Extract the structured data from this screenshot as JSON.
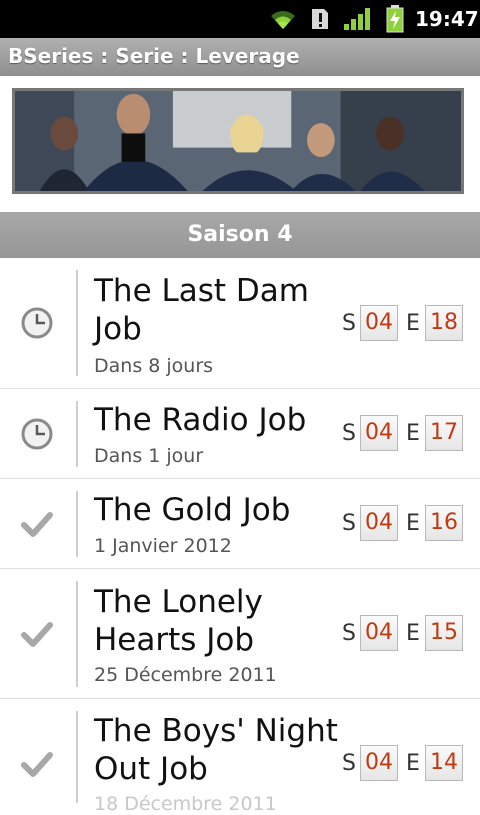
{
  "status_bar": {
    "time": "19:47"
  },
  "app": {
    "title": "BSeries : Serie : Leverage"
  },
  "banner": {
    "alt": "Leverage cast photo"
  },
  "season": {
    "label": "Saison 4"
  },
  "labels": {
    "season_prefix": "S",
    "episode_prefix": "E"
  },
  "episodes": [
    {
      "title": "The Last Dam Job",
      "date": "Dans 8 jours",
      "season": "04",
      "episode": "18",
      "status": "upcoming"
    },
    {
      "title": "The Radio Job",
      "date": "Dans 1 jour",
      "season": "04",
      "episode": "17",
      "status": "upcoming"
    },
    {
      "title": "The Gold Job",
      "date": "1 Janvier 2012",
      "season": "04",
      "episode": "16",
      "status": "watched"
    },
    {
      "title": "The Lonely Hearts Job",
      "date": "25 Décembre 2011",
      "season": "04",
      "episode": "15",
      "status": "watched"
    },
    {
      "title": "The Boys' Night Out Job",
      "date": "18 Décembre 2011",
      "season": "04",
      "episode": "14",
      "status": "watched"
    }
  ],
  "icons": {
    "upcoming": "clock-icon",
    "watched": "checkmark-icon"
  }
}
